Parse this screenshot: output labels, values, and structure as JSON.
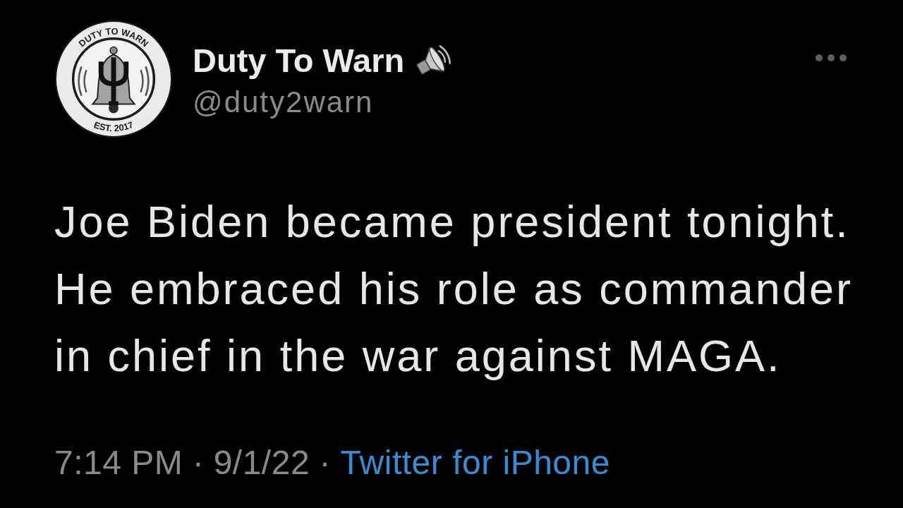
{
  "profile": {
    "avatar": {
      "ring_top": "DUTY TO WARN",
      "ring_bottom": "EST. 2017"
    },
    "display_name": "Duty To Warn",
    "handle": "@duty2warn"
  },
  "tweet": {
    "text": "Joe Biden became president tonight. He embraced his role as commander in chief in the war against MAGA."
  },
  "meta": [
    {
      "kind": "time",
      "text": "7:14 PM"
    },
    {
      "kind": "separator",
      "text": "·"
    },
    {
      "kind": "date",
      "text": "9/1/22"
    },
    {
      "kind": "separator",
      "text": "·"
    },
    {
      "kind": "link",
      "text": "Twitter for iPhone"
    }
  ]
}
